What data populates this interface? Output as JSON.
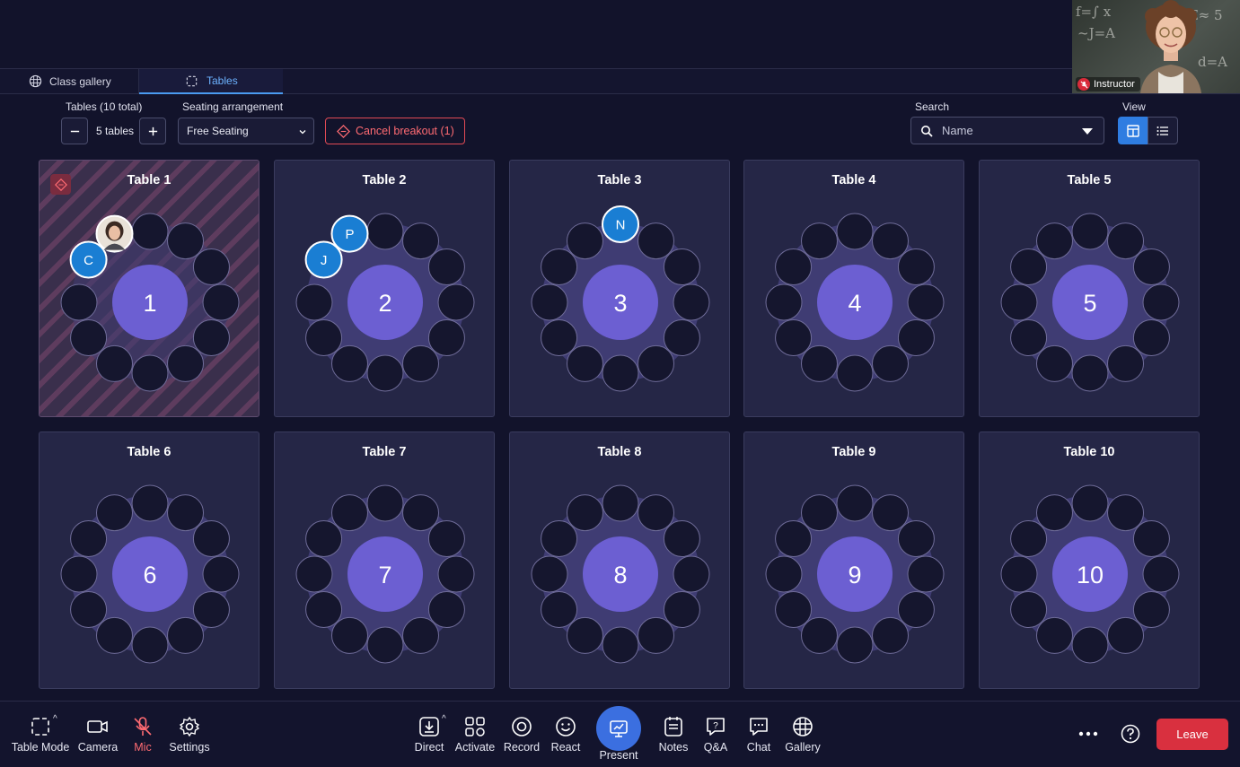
{
  "instructor": {
    "label": "Instructor"
  },
  "tabs": [
    {
      "label": "Class gallery",
      "active": false
    },
    {
      "label": "Tables",
      "active": true
    }
  ],
  "controls": {
    "tables_label": "Tables (10 total)",
    "tables_value": "5 tables",
    "seating_label": "Seating arrangement",
    "seating_value": "Free Seating",
    "cancel_breakout": "Cancel breakout (1)",
    "search_label": "Search",
    "search_value": "Name",
    "view_label": "View"
  },
  "tables": [
    {
      "title": "Table 1",
      "number": "1",
      "breakout": true,
      "occupants": [
        {
          "seat": 10,
          "initial": "C"
        },
        {
          "seat": 11,
          "photo": true
        }
      ]
    },
    {
      "title": "Table 2",
      "number": "2",
      "breakout": false,
      "occupants": [
        {
          "seat": 10,
          "initial": "J"
        },
        {
          "seat": 11,
          "initial": "P"
        }
      ]
    },
    {
      "title": "Table 3",
      "number": "3",
      "breakout": false,
      "occupants": [
        {
          "seat": 0,
          "initial": "N"
        }
      ]
    },
    {
      "title": "Table 4",
      "number": "4",
      "breakout": false,
      "occupants": []
    },
    {
      "title": "Table 5",
      "number": "5",
      "breakout": false,
      "occupants": []
    },
    {
      "title": "Table 6",
      "number": "6",
      "breakout": false,
      "occupants": []
    },
    {
      "title": "Table 7",
      "number": "7",
      "breakout": false,
      "occupants": []
    },
    {
      "title": "Table 8",
      "number": "8",
      "breakout": false,
      "occupants": []
    },
    {
      "title": "Table 9",
      "number": "9",
      "breakout": false,
      "occupants": []
    },
    {
      "title": "Table 10",
      "number": "10",
      "breakout": false,
      "occupants": []
    }
  ],
  "toolbar": {
    "table_mode": "Table Mode",
    "camera": "Camera",
    "mic": "Mic",
    "settings": "Settings",
    "direct": "Direct",
    "activate": "Activate",
    "record": "Record",
    "react": "React",
    "present": "Present",
    "notes": "Notes",
    "qa": "Q&A",
    "chat": "Chat",
    "gallery": "Gallery",
    "leave": "Leave"
  },
  "colors": {
    "background": "#12132b",
    "accent": "#2f7de1",
    "table_center": "#6c5fd2",
    "avatar": "#1a7ed3",
    "danger": "#d9303f"
  }
}
